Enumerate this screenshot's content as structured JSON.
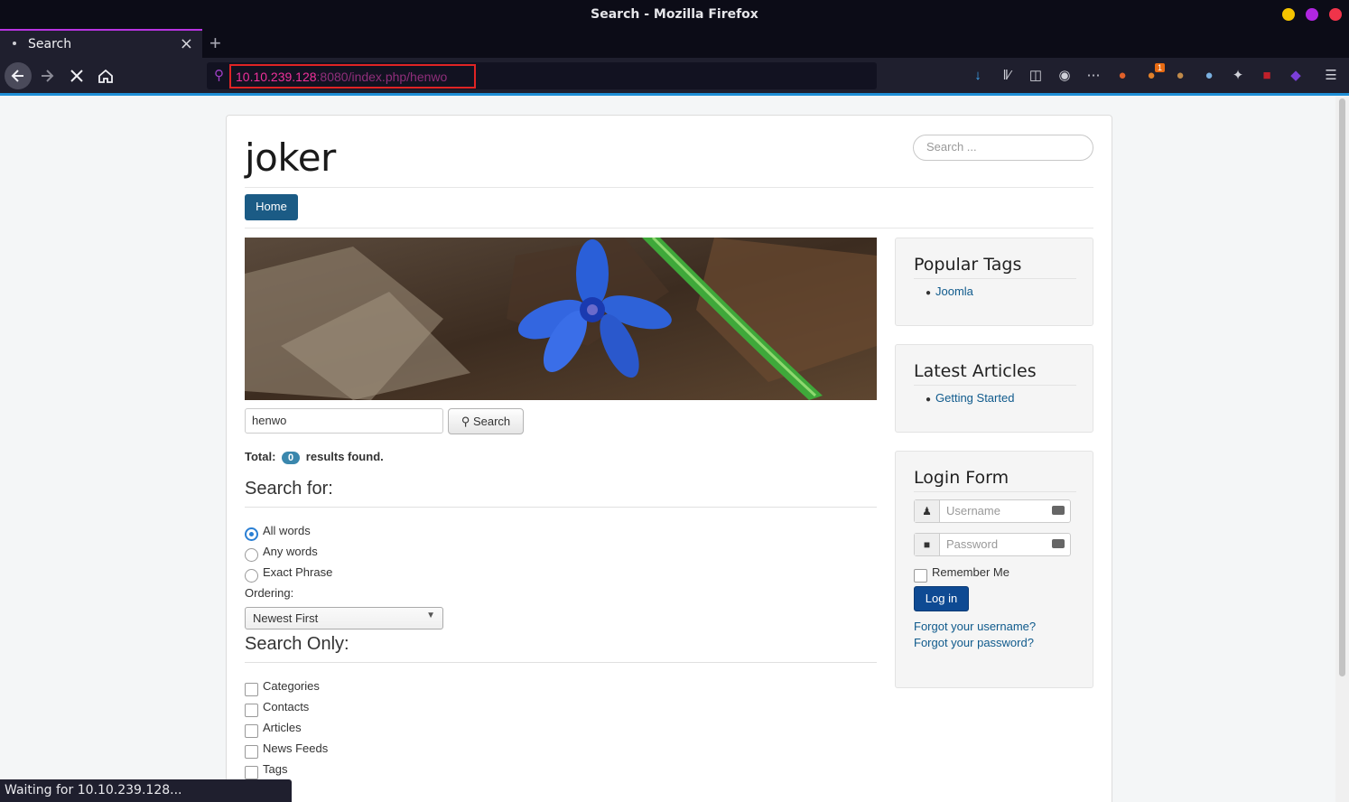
{
  "window": {
    "title": "Search - Mozilla Firefox"
  },
  "tab": {
    "label": "Search"
  },
  "url": {
    "host": "10.10.239.128",
    "rest": ":8080/index.php/henwo"
  },
  "toolbar": {
    "notification_count": "1"
  },
  "site": {
    "brand": "joker",
    "search_placeholder": "Search ...",
    "menu": [
      {
        "label": "Home"
      }
    ]
  },
  "search": {
    "query": "henwo",
    "button_label": "Search",
    "total_prefix": "Total:",
    "total_count": "0",
    "total_suffix": "results found.",
    "search_for_heading": "Search for:",
    "modes": [
      {
        "label": "All words",
        "selected": true
      },
      {
        "label": "Any words",
        "selected": false
      },
      {
        "label": "Exact Phrase",
        "selected": false
      }
    ],
    "ordering_label": "Ordering:",
    "ordering_value": "Newest First",
    "search_only_heading": "Search Only:",
    "areas": [
      {
        "label": "Categories",
        "checked": false
      },
      {
        "label": "Contacts",
        "checked": false
      },
      {
        "label": "Articles",
        "checked": false
      },
      {
        "label": "News Feeds",
        "checked": false
      },
      {
        "label": "Tags",
        "checked": false
      }
    ]
  },
  "sidebar": {
    "popular_tags": {
      "title": "Popular Tags",
      "items": [
        "Joomla"
      ]
    },
    "latest_articles": {
      "title": "Latest Articles",
      "items": [
        "Getting Started"
      ]
    },
    "login": {
      "title": "Login Form",
      "username_placeholder": "Username",
      "password_placeholder": "Password",
      "remember_label": "Remember Me",
      "button_label": "Log in",
      "forgot_username": "Forgot your username?",
      "forgot_password": "Forgot your password?"
    }
  },
  "status": {
    "text": "Waiting for 10.10.239.128..."
  },
  "colors": {
    "accent": "#1b5b85",
    "browser_accent": "#1f8fd6",
    "url_highlight": "#f0309a",
    "window_min": "#f5c400",
    "window_max": "#b026e0",
    "window_close": "#f0344a"
  }
}
